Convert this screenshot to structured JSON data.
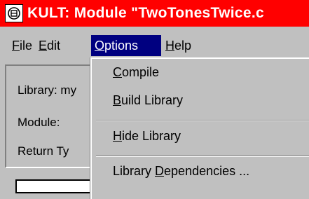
{
  "window": {
    "title": "KULT: Module \"TwoTonesTwice.c"
  },
  "menubar": {
    "items": [
      {
        "label": "File",
        "mnemonic": "F",
        "rest": "ile"
      },
      {
        "label": "Edit",
        "mnemonic": "E",
        "rest": "dit"
      },
      {
        "label": "Options",
        "mnemonic": "O",
        "rest": "ptions"
      },
      {
        "label": "Help",
        "mnemonic": "H",
        "rest": "elp"
      }
    ]
  },
  "form": {
    "library_label": "Library: my",
    "module_label": "Module:",
    "return_label": "Return Ty"
  },
  "options_menu": {
    "compile": {
      "label": "Compile",
      "mnemonic": "C",
      "rest": "ompile"
    },
    "build": {
      "label": "Build Library",
      "mnemonic": "B",
      "rest": "uild Library"
    },
    "hide": {
      "label": "Hide Library",
      "mnemonic": "H",
      "rest": "ide Library"
    },
    "deps": {
      "label": "Library Dependencies ...",
      "pre": "Library ",
      "mnemonic": "D",
      "rest": "ependencies ..."
    }
  },
  "colors": {
    "titlebar": "#ff0000",
    "menu_highlight": "#000080",
    "face": "#c0c0c0"
  },
  "icons": {
    "system_menu": "system-menu-icon"
  }
}
